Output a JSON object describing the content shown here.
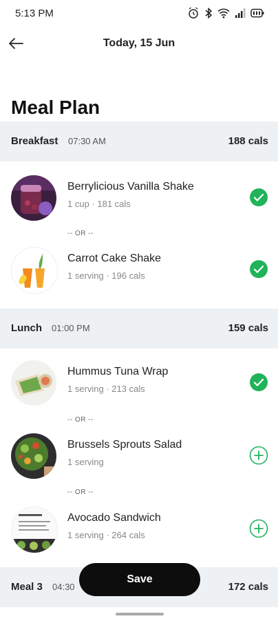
{
  "status": {
    "time": "5:13 PM"
  },
  "header": {
    "title": "Today, 15 Jun"
  },
  "page": {
    "title": "Meal Plan"
  },
  "sections": [
    {
      "name": "Breakfast",
      "time": "07:30 AM",
      "cals": "188 cals"
    },
    {
      "name": "Lunch",
      "time": "01:00 PM",
      "cals": "159 cals"
    },
    {
      "name": "Meal 3",
      "time": "04:30",
      "cals": "172 cals"
    }
  ],
  "meals": [
    {
      "name": "Berrylicious Vanilla Shake",
      "sub": "1 cup  ·  181 cals",
      "state": "checked"
    },
    {
      "name": "Carrot Cake Shake",
      "sub": "1 serving  ·  196 cals",
      "state": "checked"
    },
    {
      "name": "Hummus Tuna Wrap",
      "sub": "1 serving  ·  213 cals",
      "state": "checked"
    },
    {
      "name": "Brussels Sprouts Salad",
      "sub": "1 serving",
      "state": "add"
    },
    {
      "name": "Avocado Sandwich",
      "sub": "1 serving  ·  264 cals",
      "state": "add"
    }
  ],
  "separator": "-- OR --",
  "actions": {
    "save_label": "Save"
  },
  "colors": {
    "accent": "#21b35b",
    "section_bg": "#eef1f4",
    "button_bg": "#0d0d0d"
  }
}
